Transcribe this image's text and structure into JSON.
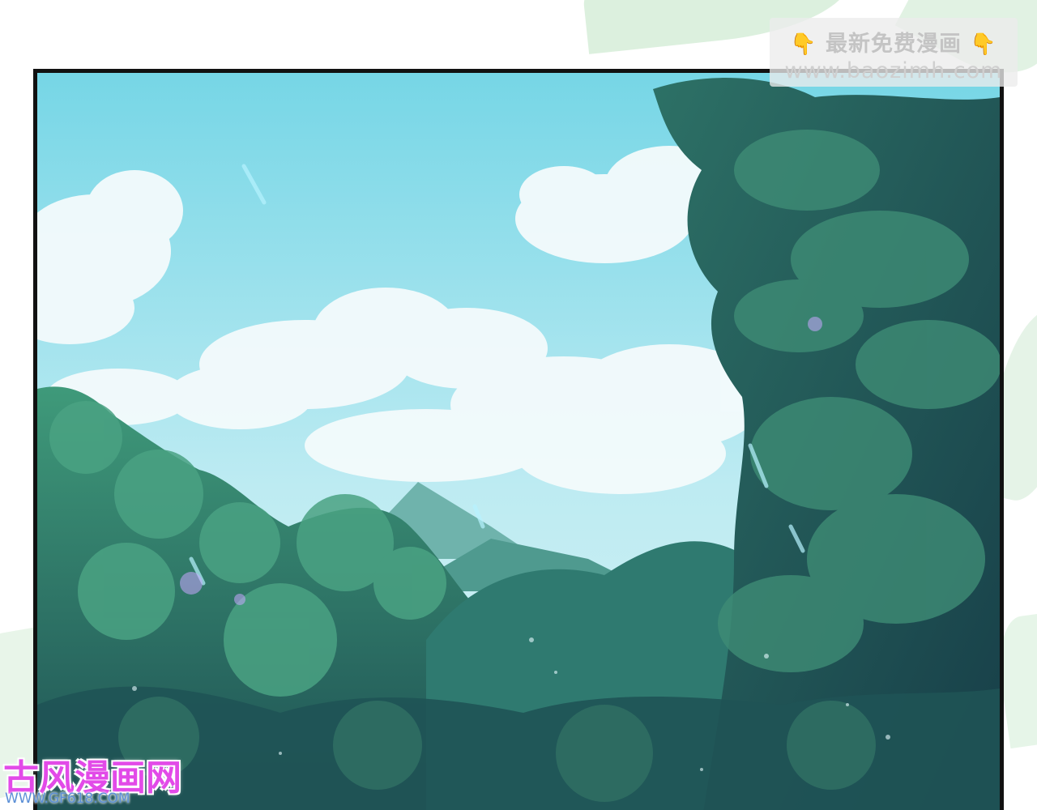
{
  "watermark_top": {
    "line1": "最新免费漫画",
    "line2": "www.baozimh.com",
    "icon_left": "pointing-hand-icon",
    "icon_right": "pointing-hand-icon"
  },
  "watermark_bottom": {
    "brand": "古风漫画网",
    "url": "WWW.GF618.COM"
  },
  "colors": {
    "sky_top": "#7fd8e6",
    "sky_bottom": "#c8eef3",
    "forest_dark": "#1f5a52",
    "forest_mid": "#3f8f72",
    "mountain": "#5fa8a0",
    "border": "#111111"
  }
}
